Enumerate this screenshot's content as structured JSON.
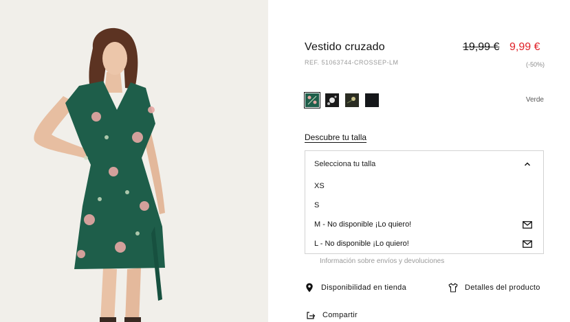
{
  "product": {
    "title": "Vestido cruzado",
    "ref": "REF. 51063744-CROSSEP-LM",
    "old_price": "19,99 €",
    "new_price": "9,99 €",
    "discount": "(-50%)",
    "selected_color": "Verde"
  },
  "swatches": [
    {
      "name": "green-floral",
      "color": "#1e5e4a"
    },
    {
      "name": "black-white-floral",
      "color": "#1a1a1a"
    },
    {
      "name": "dark-floral",
      "color": "#2a2c22"
    },
    {
      "name": "black",
      "color": "#15171a"
    }
  ],
  "size_selector": {
    "discover_label": "Descubre tu talla",
    "placeholder": "Selecciona tu talla",
    "options": [
      {
        "label": "XS",
        "notify": false
      },
      {
        "label": "S",
        "notify": false
      },
      {
        "label": "M - No disponible ¡Lo quiero!",
        "notify": true
      },
      {
        "label": "L - No disponible ¡Lo quiero!",
        "notify": true
      }
    ]
  },
  "shipping_info": "Información sobre envíos y devoluciones",
  "actions": {
    "availability": "Disponibilidad en tienda",
    "details": "Detalles del producto",
    "share": "Compartir"
  },
  "colors": {
    "price_red": "#e01f26",
    "border": "#d2d2d2",
    "muted": "#9a9a9a",
    "dress_green": "#1e5e4a"
  },
  "icons": {
    "pin": "location-pin-icon",
    "tshirt": "tshirt-icon",
    "share": "share-arrow-icon",
    "mail": "envelope-icon",
    "chevron": "chevron-up-icon"
  }
}
